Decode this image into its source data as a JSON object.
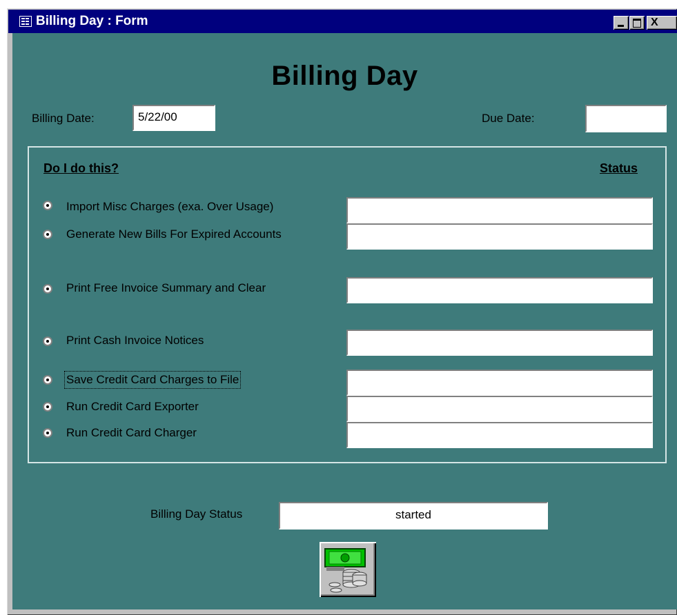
{
  "window": {
    "title": "Billing Day : Form",
    "title_icon": "form-icon",
    "controls": [
      "minimize-icon",
      "maximize-icon",
      "close-icon"
    ],
    "close_glyph": "X"
  },
  "form": {
    "heading": "Billing Day",
    "billing_date_label": "Billing Date:",
    "billing_date_value": "5/22/00",
    "due_date_label": "Due Date:",
    "due_date_value": "",
    "column_task": "Do I do this?",
    "column_status": "Status",
    "tasks": [
      {
        "label": "Import Misc Charges (exa.  Over Usage)",
        "selected": true,
        "status": ""
      },
      {
        "label": "Generate New Bills For Expired Accounts",
        "selected": true,
        "status": ""
      },
      {
        "label": "Print Free Invoice Summary and Clear",
        "selected": true,
        "status": ""
      },
      {
        "label": "Print Cash Invoice Notices",
        "selected": true,
        "status": ""
      },
      {
        "label": "Save Credit Card Charges to File",
        "selected": true,
        "status": "",
        "focused": true
      },
      {
        "label": "Run Credit Card Exporter",
        "selected": true,
        "status": ""
      },
      {
        "label": "Run Credit Card Charger",
        "selected": true,
        "status": ""
      }
    ],
    "billing_day_status_label": "Billing Day Status",
    "billing_day_status_value": "started",
    "run_button_icon": "money-coins-icon"
  },
  "colors": {
    "title_bar": "#00007e",
    "form_background": "#3e7b7b",
    "chrome": "#c0c0c0"
  }
}
